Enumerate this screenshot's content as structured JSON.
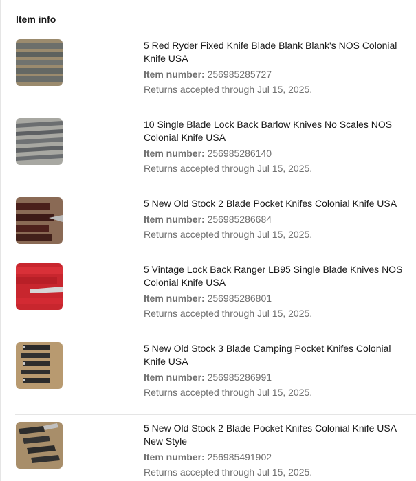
{
  "section": {
    "title": "Item info"
  },
  "labels": {
    "item_number": "Item number:"
  },
  "items": [
    {
      "title": "5 Red Ryder Fixed Knife Blade Blank Blank's NOS Colonial Knife USA",
      "item_number": "256985285727",
      "returns": "Returns accepted through Jul 15, 2025."
    },
    {
      "title": "10 Single Blade Lock Back Barlow Knives No Scales NOS Colonial Knife USA",
      "item_number": "256985286140",
      "returns": "Returns accepted through Jul 15, 2025."
    },
    {
      "title": "5 New Old Stock 2 Blade Pocket Knifes Colonial Knife USA",
      "item_number": "256985286684",
      "returns": "Returns accepted through Jul 15, 2025."
    },
    {
      "title": "5 Vintage Lock Back Ranger LB95 Single Blade Knives NOS Colonial Knife USA",
      "item_number": "256985286801",
      "returns": "Returns accepted through Jul 15, 2025."
    },
    {
      "title": "5 New Old Stock 3 Blade Camping Pocket Knifes Colonial Knife USA",
      "item_number": "256985286991",
      "returns": "Returns accepted through Jul 15, 2025."
    },
    {
      "title": "5 New Old Stock 2 Blade Pocket Knifes Colonial Knife USA New Style",
      "item_number": "256985491902",
      "returns": "Returns accepted through Jul 15, 2025."
    }
  ]
}
